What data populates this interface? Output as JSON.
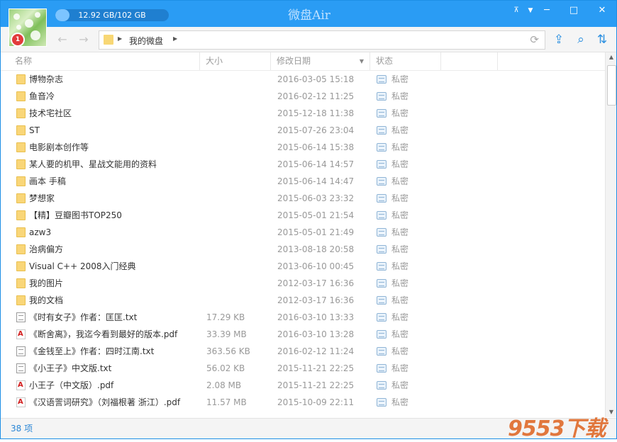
{
  "app": {
    "title": "微盘Air"
  },
  "quota": {
    "label": "12.92 GB/102 GB",
    "used_fraction": 0.127
  },
  "window_controls": {
    "menu": "▼",
    "minimize": "─",
    "restore": "□",
    "close": "✕",
    "pin": "⊼"
  },
  "breadcrumb": {
    "root": "我的微盘"
  },
  "columns": {
    "name": "名称",
    "size": "大小",
    "modified": "修改日期",
    "status": "状态"
  },
  "files": [
    {
      "type": "folder",
      "name": "博物杂志",
      "size": "",
      "date": "2016-03-05 15:18",
      "status": "私密"
    },
    {
      "type": "folder",
      "name": "鱼音冷",
      "size": "",
      "date": "2016-02-12 11:25",
      "status": "私密"
    },
    {
      "type": "folder",
      "name": "技术宅社区",
      "size": "",
      "date": "2015-12-18 11:38",
      "status": "私密"
    },
    {
      "type": "folder",
      "name": "ST",
      "size": "",
      "date": "2015-07-26 23:04",
      "status": "私密"
    },
    {
      "type": "folder",
      "name": "电影剧本创作等",
      "size": "",
      "date": "2015-06-14 15:38",
      "status": "私密"
    },
    {
      "type": "folder",
      "name": "某人要的机甲、星战文能用的资料",
      "size": "",
      "date": "2015-06-14 14:57",
      "status": "私密"
    },
    {
      "type": "folder",
      "name": "画本 手稿",
      "size": "",
      "date": "2015-06-14 14:47",
      "status": "私密"
    },
    {
      "type": "folder",
      "name": "梦想家",
      "size": "",
      "date": "2015-06-03 23:32",
      "status": "私密"
    },
    {
      "type": "folder",
      "name": "【精】豆瓣图书TOP250",
      "size": "",
      "date": "2015-05-01 21:54",
      "status": "私密"
    },
    {
      "type": "folder",
      "name": "azw3",
      "size": "",
      "date": "2015-05-01 21:49",
      "status": "私密"
    },
    {
      "type": "folder",
      "name": "治病偏方",
      "size": "",
      "date": "2013-08-18 20:58",
      "status": "私密"
    },
    {
      "type": "folder",
      "name": "Visual C++ 2008入门经典",
      "size": "",
      "date": "2013-06-10 00:45",
      "status": "私密"
    },
    {
      "type": "folder",
      "name": "我的图片",
      "size": "",
      "date": "2012-03-17 16:36",
      "status": "私密"
    },
    {
      "type": "folder",
      "name": "我的文档",
      "size": "",
      "date": "2012-03-17 16:36",
      "status": "私密"
    },
    {
      "type": "txt",
      "name": "《时有女子》作者：匡匡.txt",
      "size": "17.29 KB",
      "date": "2016-03-10 13:33",
      "status": "私密"
    },
    {
      "type": "pdf",
      "name": "《断舍离》，我迄今看到最好的版本.pdf",
      "size": "33.39 MB",
      "date": "2016-03-10 13:28",
      "status": "私密"
    },
    {
      "type": "txt",
      "name": "《金钱至上》作者：四时江南.txt",
      "size": "363.56 KB",
      "date": "2016-02-12 11:24",
      "status": "私密"
    },
    {
      "type": "txt",
      "name": "《小王子》中文版.txt",
      "size": "56.02 KB",
      "date": "2015-11-21 22:25",
      "status": "私密"
    },
    {
      "type": "pdf",
      "name": "小王子（中文版）.pdf",
      "size": "2.08 MB",
      "date": "2015-11-21 22:25",
      "status": "私密"
    },
    {
      "type": "pdf",
      "name": "《汉语詈词研究》（刘福根著 浙江）.pdf",
      "size": "11.57 MB",
      "date": "2015-10-09 22:11",
      "status": "私密"
    }
  ],
  "status_bar": {
    "count": "38 项"
  },
  "watermark": {
    "text": "9553下载"
  }
}
